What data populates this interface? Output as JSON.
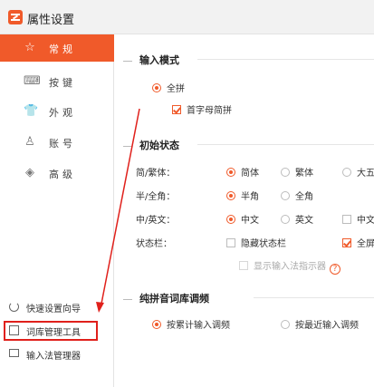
{
  "window": {
    "title": "属性设置"
  },
  "sidebar": {
    "items": [
      {
        "label": "常规",
        "icon": "star-icon",
        "active": true
      },
      {
        "label": "按键",
        "icon": "keyboard-icon",
        "active": false
      },
      {
        "label": "外观",
        "icon": "shirt-icon",
        "active": false
      },
      {
        "label": "账号",
        "icon": "user-icon",
        "active": false
      },
      {
        "label": "高级",
        "icon": "layers-icon",
        "active": false
      }
    ],
    "tools": [
      {
        "label": "快速设置向导",
        "icon": "power-icon"
      },
      {
        "label": "词库管理工具",
        "icon": "dictionary-icon",
        "highlighted": true
      },
      {
        "label": "输入法管理器",
        "icon": "monitor-icon"
      }
    ]
  },
  "input_mode": {
    "heading": "输入模式",
    "option_full_pinyin": "全拼",
    "option_initial_letter": "首字母简拼"
  },
  "initial_state": {
    "heading": "初始状态",
    "rows": [
      {
        "label": "简/繁体：",
        "options": [
          "简体",
          "繁体",
          "大五"
        ],
        "selected": 0
      },
      {
        "label": "半/全角：",
        "options": [
          "半角",
          "全角"
        ],
        "selected": 0
      },
      {
        "label": "中/英文：",
        "options": [
          "中文",
          "英文",
          "中文"
        ],
        "selected": 0
      }
    ],
    "status_bar_label": "状态栏：",
    "hide_status_bar": "隐藏状态栏",
    "fullscreen": "全屏",
    "show_indicator": "显示输入法指示器"
  },
  "lexicon": {
    "heading": "纯拼音词库调频",
    "option_cumulative": "按累计输入调频",
    "option_recent": "按最近输入调频"
  },
  "colors": {
    "accent": "#f05a2a",
    "annotation": "#e0201b"
  }
}
